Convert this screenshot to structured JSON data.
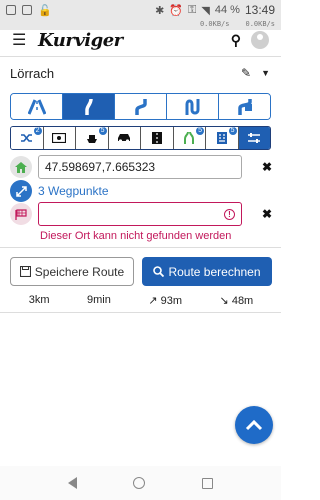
{
  "status": {
    "time": "13:49",
    "battery": "44 %",
    "speed_up": "0.0KB/s",
    "speed_down": "0.0KB/s"
  },
  "app": {
    "logo": "Kurviger"
  },
  "location": {
    "name": "Lörrach"
  },
  "road_types": [
    "highway-icon",
    "curvy-icon",
    "extra-curvy-icon",
    "super-curvy-icon",
    "custom-icon"
  ],
  "options": [
    {
      "icon": "shuffle-icon",
      "badge": "2"
    },
    {
      "icon": "money-icon",
      "badge": ""
    },
    {
      "icon": "ferry-icon",
      "badge": "5"
    },
    {
      "icon": "car-icon",
      "badge": ""
    },
    {
      "icon": "toll-road-icon",
      "badge": ""
    },
    {
      "icon": "mountain-pass-icon",
      "badge": "5"
    },
    {
      "icon": "terrain-icon",
      "badge": "5"
    },
    {
      "icon": "settings-sliders-icon",
      "badge": ""
    }
  ],
  "waypoints": {
    "start_value": "47.598697,7.665323",
    "middle_label": "3 Wegpunkte",
    "end_value": "",
    "error_message": "Dieser Ort kann nicht gefunden werden"
  },
  "actions": {
    "save_label": "Speichere Route",
    "calc_label": "Route berechnen"
  },
  "stats": {
    "distance": "3km",
    "duration": "9min",
    "ascent": "↗ 93m",
    "descent": "↘ 48m"
  },
  "colors": {
    "accent": "#1f5fb2",
    "error": "#c2185b"
  }
}
